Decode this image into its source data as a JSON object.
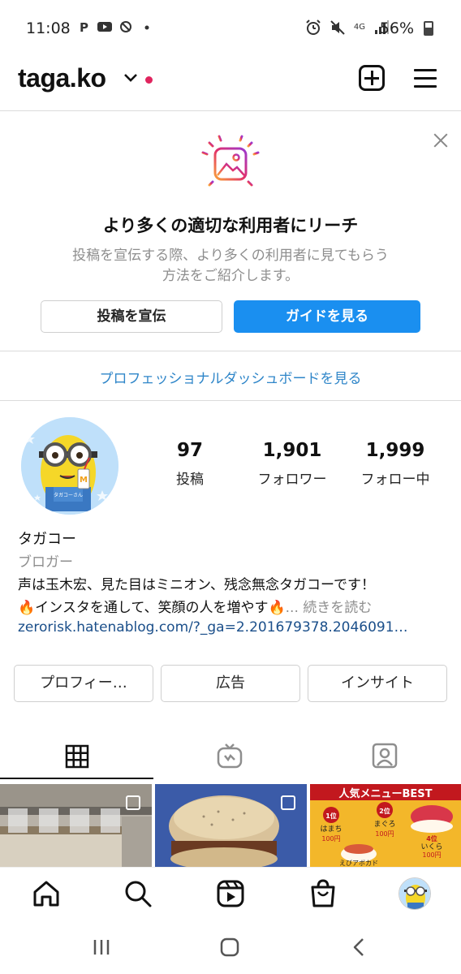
{
  "status_bar": {
    "time": "11:08",
    "network": "4G",
    "battery": "56%"
  },
  "header": {
    "username": "taga.ko"
  },
  "promo": {
    "title": "より多くの適切な利用者にリーチ",
    "description_line1": "投稿を宣伝する際、より多くの利用者に見てもらう",
    "description_line2": "方法をご紹介します。",
    "promote_button": "投稿を宣伝",
    "guide_button": "ガイドを見る"
  },
  "dashboard_link": "プロフェッショナルダッシュボードを見る",
  "profile": {
    "stats": [
      {
        "value": "97",
        "label": "投稿"
      },
      {
        "value": "1,901",
        "label": "フォロワー"
      },
      {
        "value": "1,999",
        "label": "フォロー中"
      }
    ],
    "name": "タガコー",
    "category": "ブロガー",
    "bio_line1": "声は玉木宏、見た目はミニオン、残念無念タガコーです！",
    "bio_line2": "🔥インスタを通して、笑顔の人を増やす🔥",
    "bio_more": "... 続きを読む",
    "link": "zerorisk.hatenablog.com/?_ga=2.201679378.2046091…",
    "avatar_text": "タガコーさん"
  },
  "profile_buttons": {
    "profile": "プロフィー…",
    "ads": "広告",
    "insights": "インサイト"
  },
  "grid_images": {
    "third_header": "人気メニューBEST",
    "items": [
      {
        "rank": "1位",
        "name": "はまち",
        "price": "100円"
      },
      {
        "rank": "2位",
        "name": "まぐろ",
        "price": "100円"
      },
      {
        "rank": "4位",
        "name": "いくら",
        "price": "100円"
      },
      {
        "rank": "",
        "name": "えびアボカド",
        "price": ""
      }
    ]
  },
  "colors": {
    "accent_blue": "#1a8ff0",
    "link_blue": "#2f86c9",
    "notification_red": "#e0245e"
  }
}
